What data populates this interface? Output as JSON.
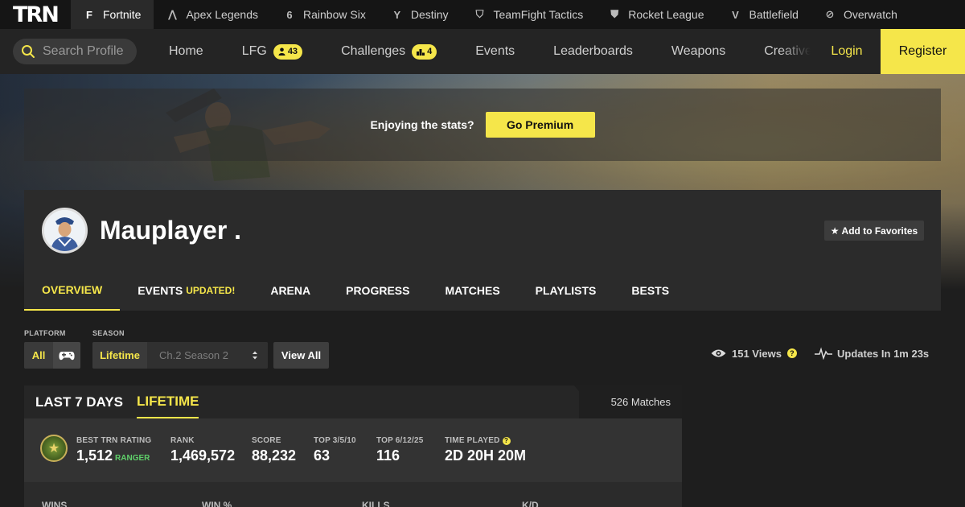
{
  "brand": {
    "logo": "TRN",
    "accent": "#f5e64a"
  },
  "games": [
    {
      "label": "Fortnite",
      "icon": "fortnite-icon",
      "glyph": "F",
      "active": true
    },
    {
      "label": "Apex Legends",
      "icon": "apex-icon",
      "glyph": "⋀",
      "active": false
    },
    {
      "label": "Rainbow Six",
      "icon": "rainbow-six-icon",
      "glyph": "6",
      "active": false
    },
    {
      "label": "Destiny",
      "icon": "destiny-icon",
      "glyph": "Y",
      "active": false
    },
    {
      "label": "TeamFight Tactics",
      "icon": "tft-icon",
      "glyph": "⛉",
      "active": false
    },
    {
      "label": "Rocket League",
      "icon": "rocket-league-icon",
      "glyph": "⛊",
      "active": false
    },
    {
      "label": "Battlefield",
      "icon": "battlefield-icon",
      "glyph": "V",
      "active": false
    },
    {
      "label": "Overwatch",
      "icon": "overwatch-icon",
      "glyph": "⊘",
      "active": false
    }
  ],
  "nav": {
    "search_placeholder": "Search Profile",
    "home": "Home",
    "lfg": "LFG",
    "lfg_count": "43",
    "challenges": "Challenges",
    "challenges_count": "4",
    "events": "Events",
    "leaderboards": "Leaderboards",
    "weapons": "Weapons",
    "creative": "Creative",
    "login": "Login",
    "register": "Register"
  },
  "promo": {
    "text": "Enjoying the stats?",
    "button": "Go Premium"
  },
  "profile": {
    "name": "Mauplayer .",
    "favorite": "Add to Favorites",
    "tabs": {
      "overview": "OVERVIEW",
      "events": "EVENTS",
      "events_badge": "UPDATED!",
      "arena": "ARENA",
      "progress": "PROGRESS",
      "matches": "MATCHES",
      "playlists": "PLAYLISTS",
      "bests": "BESTS"
    }
  },
  "filters": {
    "platform_label": "PLATFORM",
    "platform_value": "All",
    "season_label": "SEASON",
    "season_value": "Lifetime",
    "season_select": "Ch.2 Season 2",
    "view_all": "View All",
    "views": "151 Views",
    "updates": "Updates In 1m 23s"
  },
  "stats": {
    "tab_last7": "LAST 7 DAYS",
    "tab_lifetime": "LIFETIME",
    "matches": "526 Matches",
    "best_rating_label": "BEST TRN RATING",
    "best_rating_value": "1,512",
    "best_rating_rank": "RANGER",
    "rank_label": "RANK",
    "rank_value": "1,469,572",
    "score_label": "SCORE",
    "score_value": "88,232",
    "top3_label": "TOP 3/5/10",
    "top3_value": "63",
    "top6_label": "TOP 6/12/25",
    "top6_value": "116",
    "time_label": "TIME PLAYED",
    "time_value": "2D 20H 20M",
    "lower_headers": [
      "WINS",
      "WIN %",
      "KILLS",
      "K/D"
    ]
  }
}
